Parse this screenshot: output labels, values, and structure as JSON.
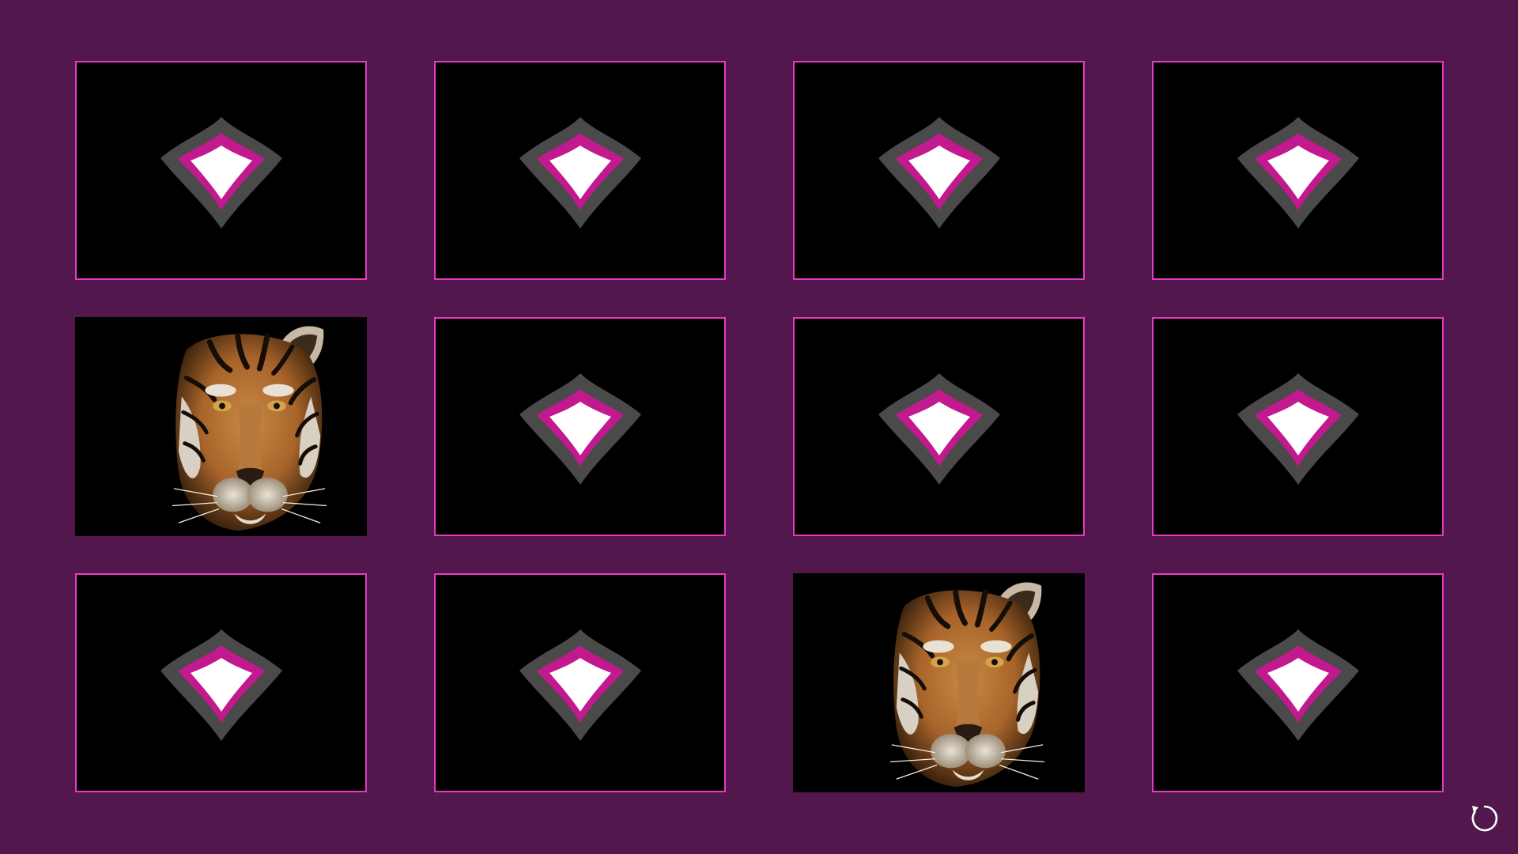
{
  "game": {
    "type": "memory-match",
    "columns": 4,
    "rows": 3,
    "cards": [
      {
        "state": "face-down"
      },
      {
        "state": "face-down"
      },
      {
        "state": "face-down"
      },
      {
        "state": "face-down"
      },
      {
        "state": "face-up",
        "image": "tiger"
      },
      {
        "state": "face-down"
      },
      {
        "state": "face-down"
      },
      {
        "state": "face-down"
      },
      {
        "state": "face-down"
      },
      {
        "state": "face-down"
      },
      {
        "state": "face-up",
        "image": "tiger"
      },
      {
        "state": "face-down"
      }
    ]
  },
  "controls": {
    "restart_icon": "restart-icon"
  },
  "colors": {
    "background": "#52174d",
    "card_border": "#e63bc0",
    "card_back": "#000000",
    "emblem_outer": "#4a4a4a",
    "emblem_middle": "#c2198f",
    "emblem_inner": "#ffffff"
  }
}
